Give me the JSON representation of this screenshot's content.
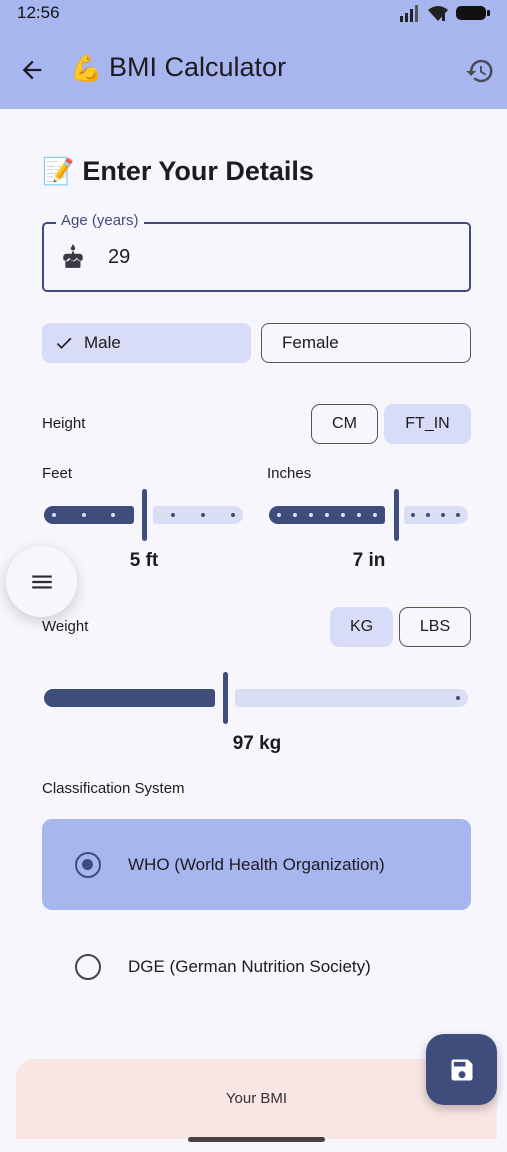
{
  "status": {
    "time": "12:56"
  },
  "appbar": {
    "title_emoji": "💪",
    "title": "BMI Calculator"
  },
  "section": {
    "emoji": "📝",
    "title": "Enter Your Details"
  },
  "age": {
    "label": "Age (years)",
    "value": "29"
  },
  "gender": {
    "male": "Male",
    "female": "Female",
    "selected": "Male"
  },
  "height": {
    "label": "Height",
    "units": [
      "CM",
      "FT_IN"
    ],
    "selected_unit": "FT_IN",
    "feet": {
      "label": "Feet",
      "value": "5 ft",
      "fraction": 0.5
    },
    "inches": {
      "label": "Inches",
      "value": "7 in",
      "fraction": 0.64
    }
  },
  "weight": {
    "label": "Weight",
    "units": [
      "KG",
      "LBS"
    ],
    "selected_unit": "KG",
    "value": "97 kg"
  },
  "classification": {
    "label": "Classification System",
    "options": [
      {
        "text": "WHO (World Health Organization)",
        "selected": true
      },
      {
        "text": "DGE (German Nutrition Society)",
        "selected": false
      }
    ]
  },
  "result": {
    "label": "Your BMI"
  },
  "colors": {
    "primary": "#3f4d7d",
    "appbar": "#a8b6ef",
    "tonal": "#d8dcf6",
    "result_bg": "#f9e5e4"
  },
  "icons": [
    "back-arrow-icon",
    "history-icon",
    "cake-icon",
    "check-icon",
    "menu-icon",
    "save-icon",
    "wifi-icon",
    "signal-icon",
    "battery-icon"
  ]
}
